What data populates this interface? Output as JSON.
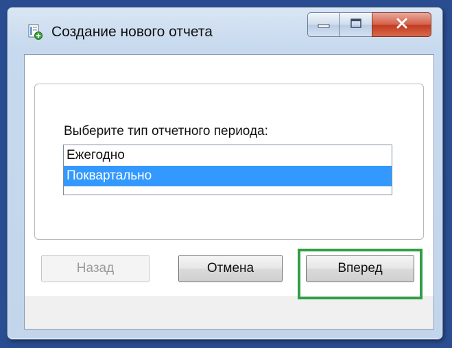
{
  "window": {
    "title": "Создание нового отчета",
    "icon": "report-add-icon"
  },
  "controls": {
    "minimize_icon": "minimize-icon",
    "maximize_icon": "maximize-icon",
    "close_icon": "close-icon"
  },
  "form": {
    "prompt": "Выберите тип отчетного периода:",
    "period_options": [
      {
        "label": "Ежегодно",
        "selected": false
      },
      {
        "label": "Поквартально",
        "selected": true
      }
    ]
  },
  "buttons": {
    "back": "Назад",
    "cancel": "Отмена",
    "next": "Вперед"
  },
  "colors": {
    "selection": "#3399ff",
    "highlight_frame": "#2f9e45",
    "desktop": "#2a4d92"
  }
}
